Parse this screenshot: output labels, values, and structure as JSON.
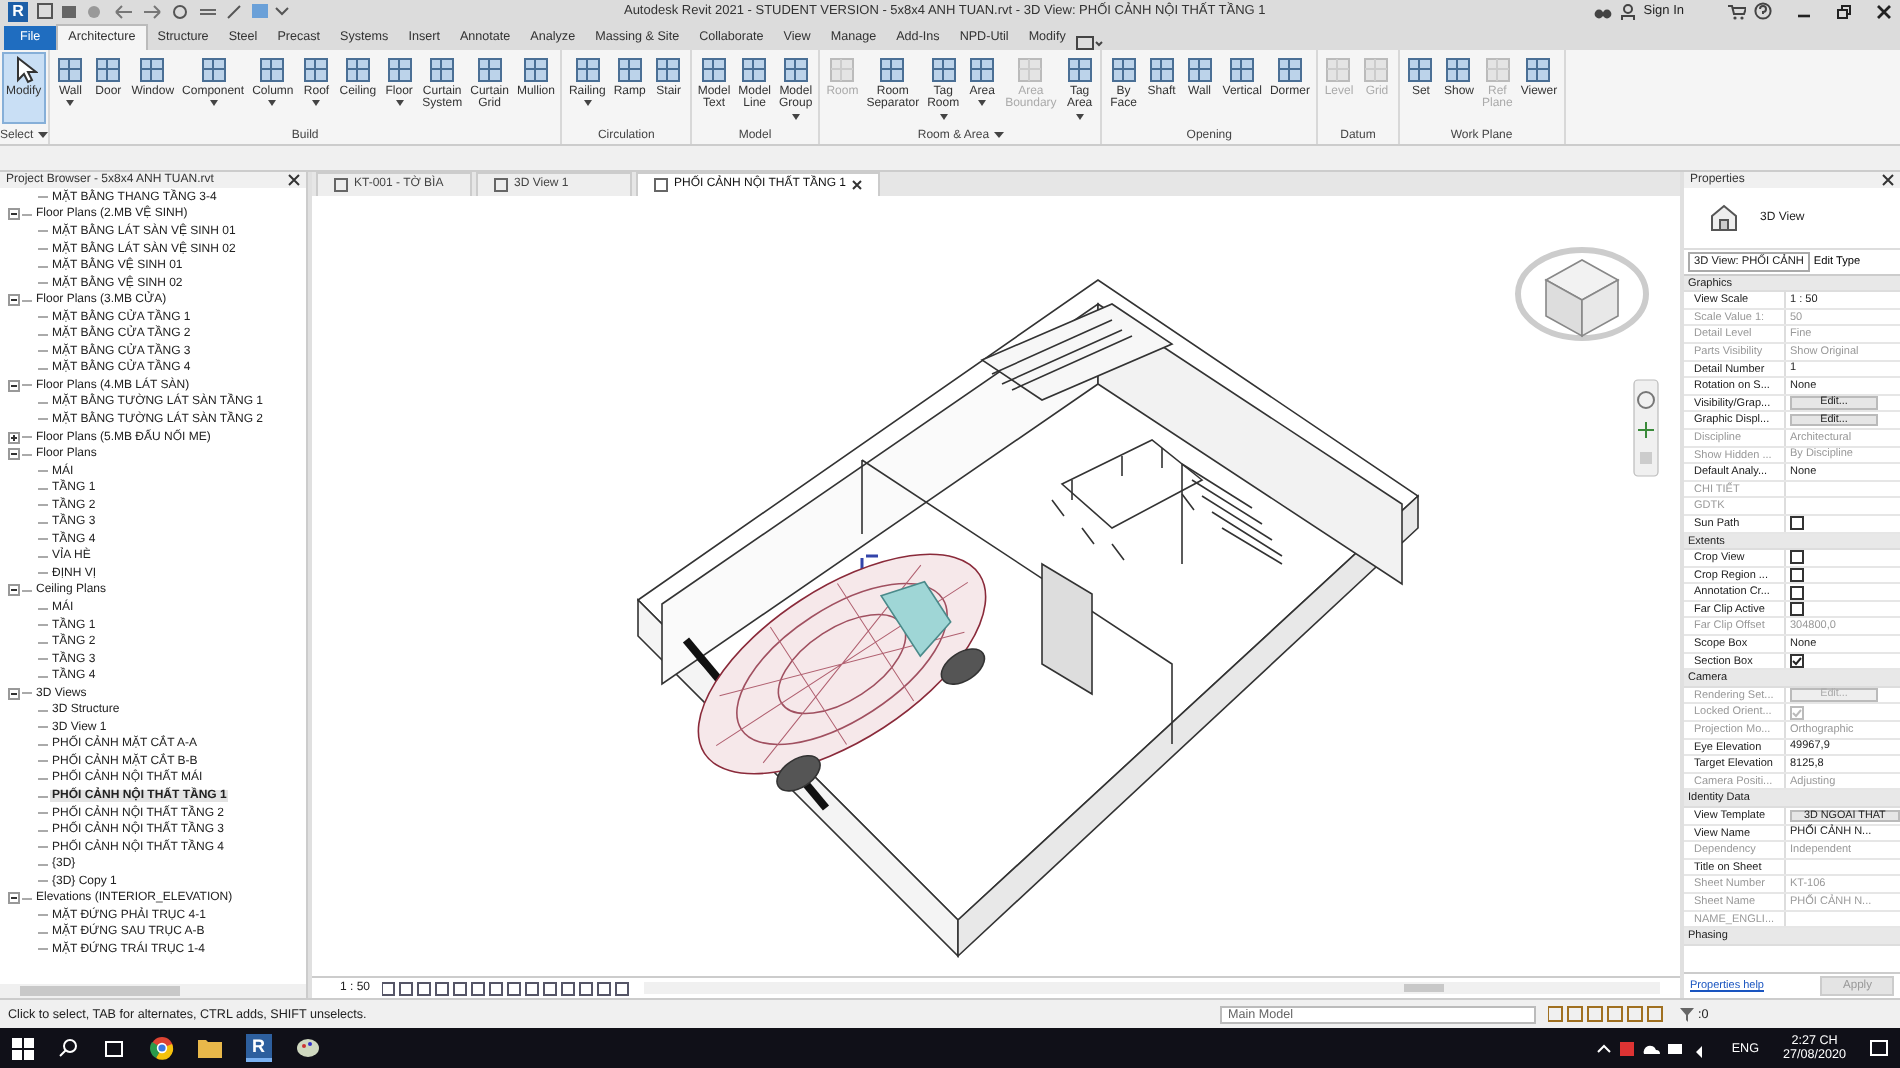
{
  "window": {
    "app_logo": "R",
    "title": "Autodesk Revit 2021 - STUDENT VERSION - 5x8x4 ANH TUAN.rvt - 3D View: PHỐI CẢNH NỘI THẤT TẦNG 1",
    "sign_in": "Sign In"
  },
  "ribbon": {
    "file_tab": "File",
    "tabs": [
      {
        "label": "Architecture",
        "selected": true
      },
      {
        "label": "Structure",
        "selected": false
      },
      {
        "label": "Steel",
        "selected": false
      },
      {
        "label": "Precast",
        "selected": false
      },
      {
        "label": "Systems",
        "selected": false
      },
      {
        "label": "Insert",
        "selected": false
      },
      {
        "label": "Annotate",
        "selected": false
      },
      {
        "label": "Analyze",
        "selected": false
      },
      {
        "label": "Massing & Site",
        "selected": false
      },
      {
        "label": "Collaborate",
        "selected": false
      },
      {
        "label": "View",
        "selected": false
      },
      {
        "label": "Manage",
        "selected": false
      },
      {
        "label": "Add-Ins",
        "selected": false
      },
      {
        "label": "NPD-Util",
        "selected": false
      },
      {
        "label": "Modify",
        "selected": false
      }
    ],
    "panels": [
      {
        "label": "Select",
        "menu": true,
        "tools": [
          {
            "label": "Modify",
            "selected": true,
            "disabled": false,
            "menu": false
          }
        ]
      },
      {
        "label": "Build",
        "menu": false,
        "tools": [
          {
            "label": "Wall",
            "selected": false,
            "disabled": false,
            "menu": true
          },
          {
            "label": "Door",
            "selected": false,
            "disabled": false,
            "menu": false
          },
          {
            "label": "Window",
            "selected": false,
            "disabled": false,
            "menu": false
          },
          {
            "label": "Component",
            "selected": false,
            "disabled": false,
            "menu": true
          },
          {
            "label": "Column",
            "selected": false,
            "disabled": false,
            "menu": true
          },
          {
            "label": "Roof",
            "selected": false,
            "disabled": false,
            "menu": true
          },
          {
            "label": "Ceiling",
            "selected": false,
            "disabled": false,
            "menu": false
          },
          {
            "label": "Floor",
            "selected": false,
            "disabled": false,
            "menu": true
          },
          {
            "label": "Curtain\nSystem",
            "selected": false,
            "disabled": false,
            "menu": false
          },
          {
            "label": "Curtain\nGrid",
            "selected": false,
            "disabled": false,
            "menu": false
          },
          {
            "label": "Mullion",
            "selected": false,
            "disabled": false,
            "menu": false
          }
        ]
      },
      {
        "label": "Circulation",
        "menu": false,
        "tools": [
          {
            "label": "Railing",
            "selected": false,
            "disabled": false,
            "menu": true
          },
          {
            "label": "Ramp",
            "selected": false,
            "disabled": false,
            "menu": false
          },
          {
            "label": "Stair",
            "selected": false,
            "disabled": false,
            "menu": false
          }
        ]
      },
      {
        "label": "Model",
        "menu": false,
        "tools": [
          {
            "label": "Model\nText",
            "selected": false,
            "disabled": false,
            "menu": false
          },
          {
            "label": "Model\nLine",
            "selected": false,
            "disabled": false,
            "menu": false
          },
          {
            "label": "Model\nGroup",
            "selected": false,
            "disabled": false,
            "menu": true
          }
        ]
      },
      {
        "label": "Room & Area",
        "menu": true,
        "tools": [
          {
            "label": "Room",
            "selected": false,
            "disabled": true,
            "menu": false
          },
          {
            "label": "Room\nSeparator",
            "selected": false,
            "disabled": false,
            "menu": false
          },
          {
            "label": "Tag\nRoom",
            "selected": false,
            "disabled": false,
            "menu": true
          },
          {
            "label": "Area",
            "selected": false,
            "disabled": false,
            "menu": true
          },
          {
            "label": "Area\nBoundary",
            "selected": false,
            "disabled": true,
            "menu": false
          },
          {
            "label": "Tag\nArea",
            "selected": false,
            "disabled": false,
            "menu": true
          }
        ]
      },
      {
        "label": "Opening",
        "menu": false,
        "tools": [
          {
            "label": "By\nFace",
            "selected": false,
            "disabled": false,
            "menu": false
          },
          {
            "label": "Shaft",
            "selected": false,
            "disabled": false,
            "menu": false
          },
          {
            "label": "Wall",
            "selected": false,
            "disabled": false,
            "menu": false
          },
          {
            "label": "Vertical",
            "selected": false,
            "disabled": false,
            "menu": false
          },
          {
            "label": "Dormer",
            "selected": false,
            "disabled": false,
            "menu": false
          }
        ]
      },
      {
        "label": "Datum",
        "menu": false,
        "tools": [
          {
            "label": "Level",
            "selected": false,
            "disabled": true,
            "menu": false
          },
          {
            "label": "Grid",
            "selected": false,
            "disabled": true,
            "menu": false
          }
        ]
      },
      {
        "label": "Work Plane",
        "menu": false,
        "tools": [
          {
            "label": "Set",
            "selected": false,
            "disabled": false,
            "menu": false
          },
          {
            "label": "Show",
            "selected": false,
            "disabled": false,
            "menu": false
          },
          {
            "label": "Ref\nPlane",
            "selected": false,
            "disabled": true,
            "menu": false
          },
          {
            "label": "Viewer",
            "selected": false,
            "disabled": false,
            "menu": false
          }
        ]
      }
    ]
  },
  "browser": {
    "title": "Project Browser - 5x8x4 ANH TUAN.rvt",
    "tree": [
      {
        "children": [
          {
            "label": "MẶT BẰNG THANG TẦNG 3-4",
            "selected": false
          }
        ]
      },
      {
        "label": "Floor Plans (2.MB VỆ SINH)",
        "expanded": true,
        "children": [
          {
            "label": "MẶT BẰNG LÁT SÀN VỆ SINH 01",
            "selected": false
          },
          {
            "label": "MẶT BẰNG LÁT SÀN VỆ SINH 02",
            "selected": false
          },
          {
            "label": "MẶT BẰNG VỆ SINH 01",
            "selected": false
          },
          {
            "label": "MẶT BẰNG VỆ SINH 02",
            "selected": false
          }
        ]
      },
      {
        "label": "Floor Plans (3.MB CỬA)",
        "expanded": true,
        "children": [
          {
            "label": "MẶT BẰNG CỬA TẦNG 1",
            "selected": false
          },
          {
            "label": "MẶT BẰNG CỬA TẦNG 2",
            "selected": false
          },
          {
            "label": "MẶT BẰNG CỬA TẦNG 3",
            "selected": false
          },
          {
            "label": "MẶT BẰNG CỬA TẦNG 4",
            "selected": false
          }
        ]
      },
      {
        "label": "Floor Plans (4.MB LÁT SÀN)",
        "expanded": true,
        "children": [
          {
            "label": "MẶT BẰNG TƯỜNG LÁT SÀN TẦNG 1",
            "selected": false
          },
          {
            "label": "MẶT BẰNG TƯỜNG LÁT SÀN TẦNG 2",
            "selected": false
          }
        ]
      },
      {
        "label": "Floor Plans (5.MB ĐẤU NỐI ME)",
        "expanded": false
      },
      {
        "label": "Floor Plans",
        "expanded": true,
        "children": [
          {
            "label": "MÁI",
            "selected": false
          },
          {
            "label": "TẦNG 1",
            "selected": false
          },
          {
            "label": "TẦNG 2",
            "selected": false
          },
          {
            "label": "TẦNG 3",
            "selected": false
          },
          {
            "label": "TẦNG 4",
            "selected": false
          },
          {
            "label": "VỈA HÈ",
            "selected": false
          },
          {
            "label": "ĐỊNH VỊ",
            "selected": false
          }
        ]
      },
      {
        "label": "Ceiling Plans",
        "expanded": true,
        "children": [
          {
            "label": "MÁI",
            "selected": false
          },
          {
            "label": "TẦNG 1",
            "selected": false
          },
          {
            "label": "TẦNG 2",
            "selected": false
          },
          {
            "label": "TẦNG 3",
            "selected": false
          },
          {
            "label": "TẦNG 4",
            "selected": false
          }
        ]
      },
      {
        "label": "3D Views",
        "expanded": true,
        "children": [
          {
            "label": "3D Structure",
            "selected": false
          },
          {
            "label": "3D View 1",
            "selected": false
          },
          {
            "label": "PHỐI CẢNH MẶT CẮT A-A",
            "selected": false
          },
          {
            "label": "PHỐI CẢNH MẶT CẮT B-B",
            "selected": false
          },
          {
            "label": "PHỐI CẢNH NỘI THẤT MÁI",
            "selected": false
          },
          {
            "label": "PHỐI CẢNH NỘI THẤT TẦNG 1",
            "selected": true
          },
          {
            "label": "PHỐI CẢNH NỘI THẤT TẦNG 2",
            "selected": false
          },
          {
            "label": "PHỐI CẢNH NỘI THẤT TẦNG 3",
            "selected": false
          },
          {
            "label": "PHỐI CẢNH NỘI THẤT TẦNG 4",
            "selected": false
          },
          {
            "label": "{3D}",
            "selected": false
          },
          {
            "label": "{3D} Copy 1",
            "selected": false
          }
        ]
      },
      {
        "label": "Elevations (INTERIOR_ELEVATION)",
        "expanded": true,
        "children": [
          {
            "label": "MẶT ĐỨNG PHẢI TRỤC 4-1",
            "selected": false
          },
          {
            "label": "MẶT ĐỨNG SAU TRỤC A-B",
            "selected": false
          },
          {
            "label": "MẶT ĐỨNG TRÁI TRỤC 1-4",
            "selected": false
          }
        ]
      }
    ]
  },
  "view_tabs": [
    {
      "label": "KT-001 - TỜ BÌA",
      "selected": false
    },
    {
      "label": "3D View 1",
      "selected": false
    },
    {
      "label": "PHỐI CẢNH NỘI THẤT TẦNG 1",
      "selected": true
    }
  ],
  "view_scale": "1 : 50",
  "properties": {
    "title": "Properties",
    "type_name": "3D View",
    "type_selector": "3D View: PHỐI CẢNH",
    "edit_type": "Edit Type",
    "sections": [
      {
        "title": "Graphics",
        "rows": [
          {
            "name": "View Scale",
            "kind": "text",
            "value": "1 : 50",
            "disabled": false
          },
          {
            "name": "Scale Value    1:",
            "kind": "text",
            "value": "50",
            "disabled": true
          },
          {
            "name": "Detail Level",
            "kind": "text",
            "value": "Fine",
            "disabled": true
          },
          {
            "name": "Parts Visibility",
            "kind": "text",
            "value": "Show Original",
            "disabled": true
          },
          {
            "name": "Detail Number",
            "kind": "text",
            "value": "1",
            "disabled": false
          },
          {
            "name": "Rotation on S...",
            "kind": "text",
            "value": "None",
            "disabled": false
          },
          {
            "name": "Visibility/Grap...",
            "kind": "button",
            "value": "Edit...",
            "disabled": false
          },
          {
            "name": "Graphic Displ...",
            "kind": "button",
            "value": "Edit...",
            "disabled": false
          },
          {
            "name": "Discipline",
            "kind": "text",
            "value": "Architectural",
            "disabled": true
          },
          {
            "name": "Show Hidden ...",
            "kind": "text",
            "value": "By Discipline",
            "disabled": true
          },
          {
            "name": "Default Analy...",
            "kind": "text",
            "value": "None",
            "disabled": false
          },
          {
            "name": "CHI TIẾT",
            "kind": "empty",
            "disabled": true
          },
          {
            "name": "GDTK",
            "kind": "empty",
            "disabled": true
          },
          {
            "name": "Sun Path",
            "kind": "check",
            "checked": false,
            "disabled": false
          }
        ]
      },
      {
        "title": "Extents",
        "rows": [
          {
            "name": "Crop View",
            "kind": "check",
            "checked": false,
            "disabled": false
          },
          {
            "name": "Crop Region ...",
            "kind": "check",
            "checked": false,
            "disabled": false
          },
          {
            "name": "Annotation Cr...",
            "kind": "check",
            "checked": false,
            "disabled": false
          },
          {
            "name": "Far Clip Active",
            "kind": "check",
            "checked": false,
            "disabled": false
          },
          {
            "name": "Far Clip Offset",
            "kind": "text",
            "value": "304800,0",
            "disabled": true
          },
          {
            "name": "Scope Box",
            "kind": "text",
            "value": "None",
            "disabled": false
          },
          {
            "name": "Section Box",
            "kind": "check",
            "checked": true,
            "disabled": false
          }
        ]
      },
      {
        "title": "Camera",
        "rows": [
          {
            "name": "Rendering Set...",
            "kind": "button",
            "value": "Edit...",
            "disabled": true
          },
          {
            "name": "Locked Orient...",
            "kind": "check",
            "checked": true,
            "disabled": true
          },
          {
            "name": "Projection Mo...",
            "kind": "text",
            "value": "Orthographic",
            "disabled": true
          },
          {
            "name": "Eye Elevation",
            "kind": "text",
            "value": "49967,9",
            "disabled": false
          },
          {
            "name": "Target Elevation",
            "kind": "text",
            "value": "8125,8",
            "disabled": false
          },
          {
            "name": "Camera Positi...",
            "kind": "text",
            "value": "Adjusting",
            "disabled": true
          }
        ]
      },
      {
        "title": "Identity Data",
        "rows": [
          {
            "name": "View Template",
            "kind": "button",
            "value": "3D NGOAI THAT",
            "disabled": false
          },
          {
            "name": "View Name",
            "kind": "text",
            "value": "PHỐI CẢNH N...",
            "disabled": false
          },
          {
            "name": "Dependency",
            "kind": "text",
            "value": "Independent",
            "disabled": true
          },
          {
            "name": "Title on Sheet",
            "kind": "empty",
            "disabled": false
          },
          {
            "name": "Sheet Number",
            "kind": "text",
            "value": "KT-106",
            "disabled": true
          },
          {
            "name": "Sheet Name",
            "kind": "text",
            "value": "PHỐI CẢNH N...",
            "disabled": true
          },
          {
            "name": "NAME_ENGLI...",
            "kind": "empty",
            "disabled": true
          }
        ]
      },
      {
        "title": "Phasing"
      }
    ],
    "help_link": "Properties help",
    "apply": "Apply"
  },
  "status_bar": {
    "message": "Click to select, TAB for alternates, CTRL adds, SHIFT unselects.",
    "model": "Main Model",
    "filter_count": ":0"
  },
  "taskbar": {
    "revit_label": "R",
    "language": "ENG",
    "time": "2:27 CH",
    "date": "27/08/2020"
  }
}
